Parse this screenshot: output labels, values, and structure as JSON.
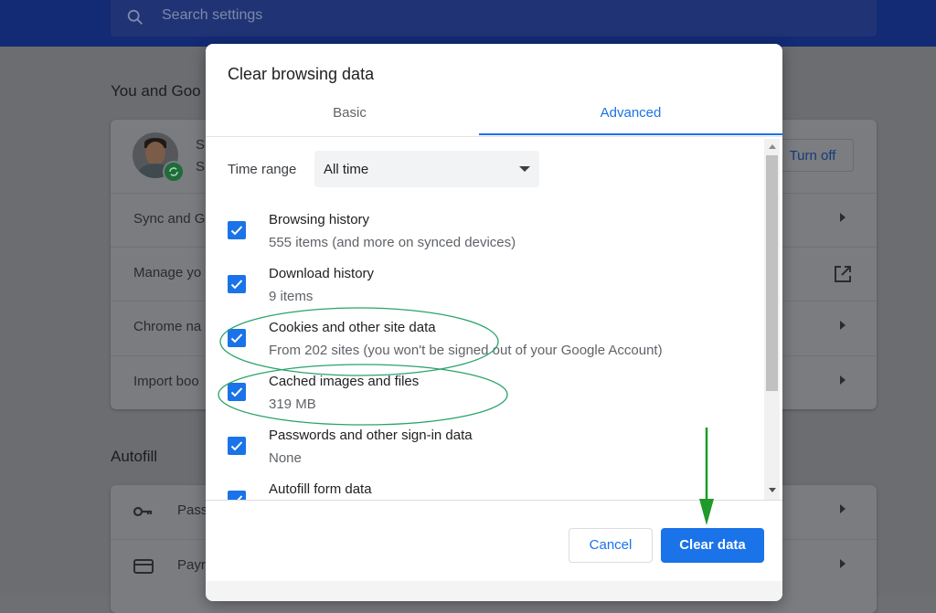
{
  "search": {
    "placeholder": "Search settings"
  },
  "background": {
    "section_you": "You and Goo",
    "profile_initial": "S",
    "turn_off": "Turn off",
    "rows": [
      {
        "label": "Sync and G"
      },
      {
        "label": "Manage yo"
      },
      {
        "label": "Chrome na"
      },
      {
        "label": "Import boo"
      }
    ],
    "section_autofill": "Autofill",
    "autofill_rows": [
      {
        "label": "Pass"
      },
      {
        "label": "Payr"
      }
    ]
  },
  "dialog": {
    "title": "Clear browsing data",
    "tabs": [
      {
        "label": "Basic",
        "active": false
      },
      {
        "label": "Advanced",
        "active": true
      }
    ],
    "time_range": {
      "label": "Time range",
      "value": "All time"
    },
    "items": [
      {
        "title": "Browsing history",
        "subtitle": "555 items (and more on synced devices)",
        "checked": true
      },
      {
        "title": "Download history",
        "subtitle": "9 items",
        "checked": true
      },
      {
        "title": "Cookies and other site data",
        "subtitle": "From 202 sites (you won't be signed out of your Google Account)",
        "checked": true
      },
      {
        "title": "Cached images and files",
        "subtitle": "319 MB",
        "checked": true
      },
      {
        "title": "Passwords and other sign-in data",
        "subtitle": "None",
        "checked": true
      },
      {
        "title": "Autofill form data",
        "subtitle": "",
        "checked": true
      }
    ],
    "buttons": {
      "cancel": "Cancel",
      "clear": "Clear data"
    }
  },
  "colors": {
    "accent": "#1a73e8",
    "annotation": "#2aa36b",
    "arrow": "#1d9a2a"
  }
}
